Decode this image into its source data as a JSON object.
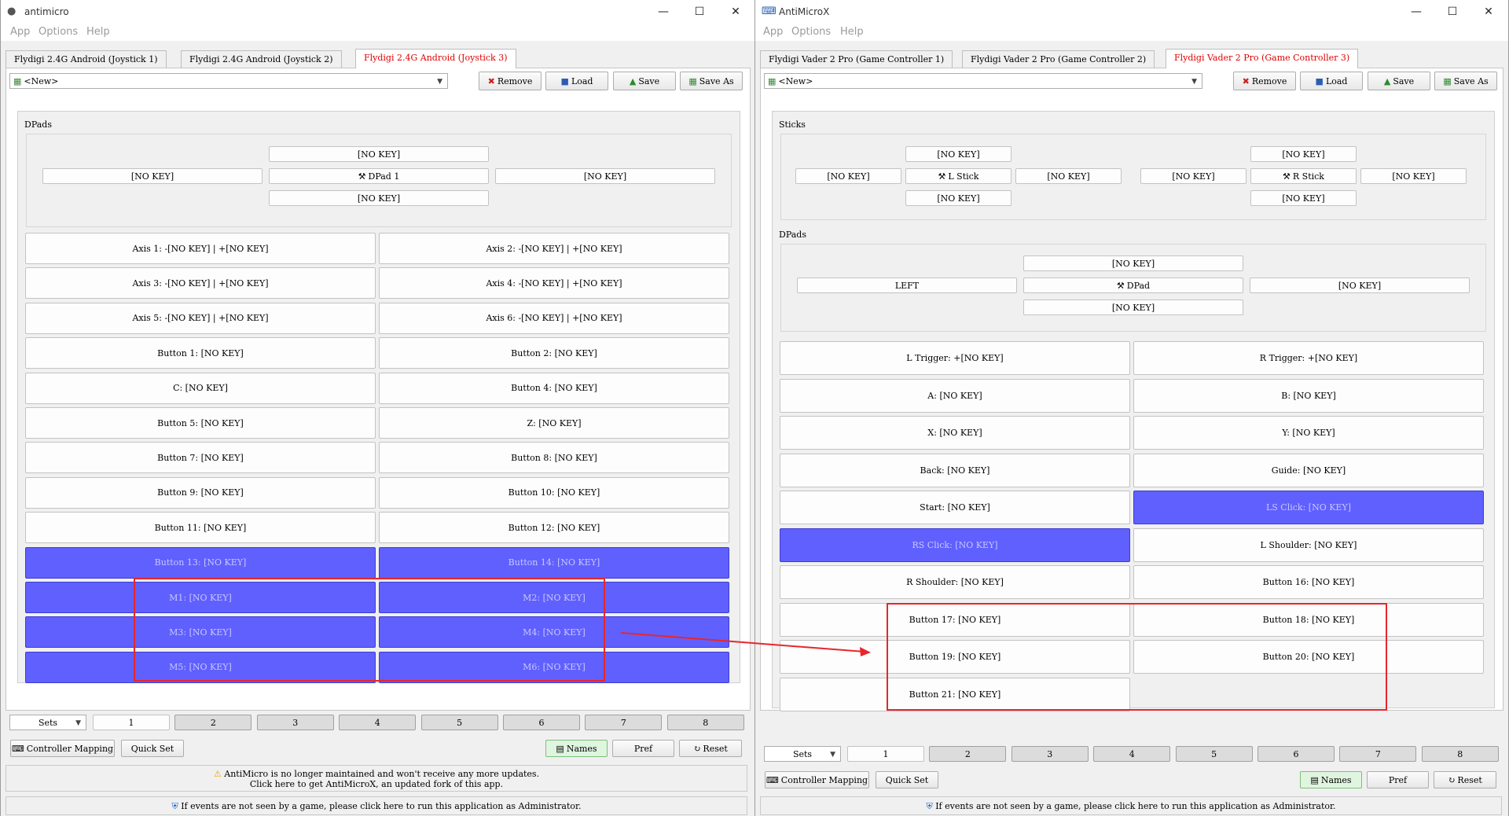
{
  "left": {
    "title": "antimicro",
    "menu": [
      "App",
      "Options",
      "Help"
    ],
    "tabs": [
      "Flydigi 2.4G Android (Joystick 1)",
      "Flydigi 2.4G Android (Joystick 2)",
      "Flydigi 2.4G Android (Joystick 3)"
    ],
    "profile": "<New>",
    "toolbar": {
      "remove": "Remove",
      "load": "Load",
      "save": "Save",
      "save_as": "Save As"
    },
    "dpads_title": "DPads",
    "dpad": {
      "up": "[NO KEY]",
      "left": "[NO KEY]",
      "center": "DPad 1",
      "right": "[NO KEY]",
      "down": "[NO KEY]"
    },
    "buttons": [
      {
        "label": "Axis 1: -[NO KEY] | +[NO KEY]",
        "state": "normal"
      },
      {
        "label": "Axis 2: -[NO KEY] | +[NO KEY]",
        "state": "normal"
      },
      {
        "label": "Axis 3: -[NO KEY] | +[NO KEY]",
        "state": "normal"
      },
      {
        "label": "Axis 4: -[NO KEY] | +[NO KEY]",
        "state": "normal"
      },
      {
        "label": "Axis 5: -[NO KEY] | +[NO KEY]",
        "state": "normal"
      },
      {
        "label": "Axis 6: -[NO KEY] | +[NO KEY]",
        "state": "normal"
      },
      {
        "label": "Button 1: [NO KEY]",
        "state": "normal"
      },
      {
        "label": "Button 2: [NO KEY]",
        "state": "normal"
      },
      {
        "label": "C: [NO KEY]",
        "state": "normal"
      },
      {
        "label": "Button 4: [NO KEY]",
        "state": "normal"
      },
      {
        "label": "Button 5: [NO KEY]",
        "state": "normal"
      },
      {
        "label": "Z: [NO KEY]",
        "state": "normal"
      },
      {
        "label": "Button 7: [NO KEY]",
        "state": "normal"
      },
      {
        "label": "Button 8: [NO KEY]",
        "state": "normal"
      },
      {
        "label": "Button 9: [NO KEY]",
        "state": "normal"
      },
      {
        "label": "Button 10: [NO KEY]",
        "state": "normal"
      },
      {
        "label": "Button 11: [NO KEY]",
        "state": "normal"
      },
      {
        "label": "Button 12: [NO KEY]",
        "state": "normal"
      },
      {
        "label": "Button 13: [NO KEY]",
        "state": "active"
      },
      {
        "label": "Button 14: [NO KEY]",
        "state": "active"
      },
      {
        "label": "M1: [NO KEY]",
        "state": "active"
      },
      {
        "label": "M2: [NO KEY]",
        "state": "active"
      },
      {
        "label": "M3: [NO KEY]",
        "state": "active"
      },
      {
        "label": "M4: [NO KEY]",
        "state": "active"
      },
      {
        "label": "M5: [NO KEY]",
        "state": "active"
      },
      {
        "label": "M6: [NO KEY]",
        "state": "active"
      }
    ],
    "sets_label": "Sets",
    "sets": [
      "1",
      "2",
      "3",
      "4",
      "5",
      "6",
      "7",
      "8"
    ],
    "bottom": {
      "controller_mapping": "Controller Mapping",
      "quick_set": "Quick Set",
      "names": "Names",
      "pref": "Pref",
      "reset": "Reset"
    },
    "notice_line1": "AntiMicro is no longer maintained and won't receive any more updates.",
    "notice_line2": "Click here to get AntiMicroX, an updated fork of this app.",
    "admin_notice": "If events are not seen by a game, please click here to run this application as Administrator."
  },
  "right": {
    "title": "AntiMicroX",
    "menu": [
      "App",
      "Options",
      "Help"
    ],
    "tabs": [
      "Flydigi Vader 2 Pro (Game Controller 1)",
      "Flydigi Vader 2 Pro (Game Controller 2)",
      "Flydigi Vader 2 Pro (Game Controller 3)"
    ],
    "profile": "<New>",
    "toolbar": {
      "remove": "Remove",
      "load": "Load",
      "save": "Save",
      "save_as": "Save As"
    },
    "sticks_title": "Sticks",
    "lstick": {
      "up": "[NO KEY]",
      "left": "[NO KEY]",
      "center": "L Stick",
      "right": "[NO KEY]",
      "down": "[NO KEY]"
    },
    "rstick": {
      "up": "[NO KEY]",
      "left": "[NO KEY]",
      "center": "R Stick",
      "right": "[NO KEY]",
      "down": "[NO KEY]"
    },
    "dpads_title": "DPads",
    "dpad": {
      "up": "[NO KEY]",
      "left": "LEFT",
      "center": "DPad",
      "right": "[NO KEY]",
      "down": "[NO KEY]"
    },
    "buttons": [
      {
        "label": "L Trigger: +[NO KEY]",
        "state": "normal"
      },
      {
        "label": "R Trigger: +[NO KEY]",
        "state": "normal"
      },
      {
        "label": "A: [NO KEY]",
        "state": "normal"
      },
      {
        "label": "B: [NO KEY]",
        "state": "normal"
      },
      {
        "label": "X: [NO KEY]",
        "state": "normal"
      },
      {
        "label": "Y: [NO KEY]",
        "state": "normal"
      },
      {
        "label": "Back: [NO KEY]",
        "state": "normal"
      },
      {
        "label": "Guide: [NO KEY]",
        "state": "normal"
      },
      {
        "label": "Start: [NO KEY]",
        "state": "normal"
      },
      {
        "label": "LS Click: [NO KEY]",
        "state": "active"
      },
      {
        "label": "RS Click: [NO KEY]",
        "state": "active"
      },
      {
        "label": "L Shoulder: [NO KEY]",
        "state": "normal"
      },
      {
        "label": "R Shoulder: [NO KEY]",
        "state": "normal"
      },
      {
        "label": "Button 16: [NO KEY]",
        "state": "normal"
      },
      {
        "label": "Button 17: [NO KEY]",
        "state": "normal"
      },
      {
        "label": "Button 18: [NO KEY]",
        "state": "normal"
      },
      {
        "label": "Button 19: [NO KEY]",
        "state": "normal"
      },
      {
        "label": "Button 20: [NO KEY]",
        "state": "normal"
      },
      {
        "label": "Button 21: [NO KEY]",
        "state": "normal"
      }
    ],
    "sets_label": "Sets",
    "sets": [
      "1",
      "2",
      "3",
      "4",
      "5",
      "6",
      "7",
      "8"
    ],
    "bottom": {
      "controller_mapping": "Controller Mapping",
      "quick_set": "Quick Set",
      "names": "Names",
      "pref": "Pref",
      "reset": "Reset"
    },
    "admin_notice": "If events are not seen by a game, please click here to run this application as Administrator."
  },
  "colors": {
    "active_button": "#6060ff",
    "active_tab_text": "#e00000",
    "highlight_box": "#e8262b"
  }
}
